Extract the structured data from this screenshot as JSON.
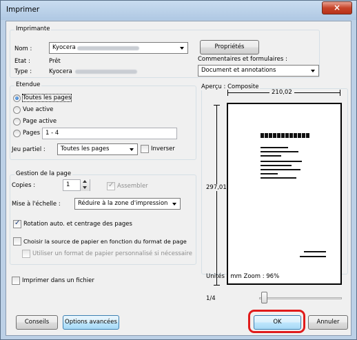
{
  "window": {
    "title": "Imprimer",
    "close_glyph": "×"
  },
  "printer": {
    "group_label": "Imprimante",
    "name_label": "Nom :",
    "name_value": "Kyocera",
    "state_label": "Etat :",
    "state_value": "Prêt",
    "type_label": "Type :",
    "type_value": "Kyocera",
    "properties_button": "Propriétés",
    "comments_label": "Commentaires et formulaires :",
    "comments_value": "Document et annotations"
  },
  "range": {
    "group_label": "Etendue",
    "all_pages": "Toutes les pages",
    "current_view": "Vue active",
    "current_page": "Page active",
    "pages": "Pages",
    "pages_value": "1 - 4",
    "subset_label": "Jeu partiel :",
    "subset_value": "Toutes les pages",
    "reverse_label": "Inverser",
    "selected": "all_pages"
  },
  "page_handling": {
    "group_label": "Gestion de la page",
    "copies_label": "Copies :",
    "copies_value": "1",
    "collate_label": "Assembler",
    "collate_checked": true,
    "scaling_label": "Mise à l'échelle :",
    "scaling_value": "Réduire à la zone d'impression",
    "auto_rotate_label": "Rotation auto. et centrage des pages",
    "auto_rotate_checked": true,
    "paper_source_label": "Choisir la source de papier en fonction du format de page",
    "paper_source_checked": false,
    "custom_paper_label": "Utiliser un format de papier personnalisé si nécessaire",
    "custom_paper_checked": false
  },
  "print_to_file_label": "Imprimer dans un fichier",
  "preview": {
    "label": "Aperçu : Composite",
    "width_value": "210,02",
    "height_value": "297,01",
    "units_label": "Unités : mm Zoom :  96%",
    "page_indicator": "1/4"
  },
  "buttons": {
    "tips": "Conseils",
    "advanced": "Options avancées",
    "ok": "OK",
    "cancel": "Annuler"
  },
  "colors": {
    "highlight": "#e01b1b",
    "titlebar": "#bcd0e6"
  }
}
